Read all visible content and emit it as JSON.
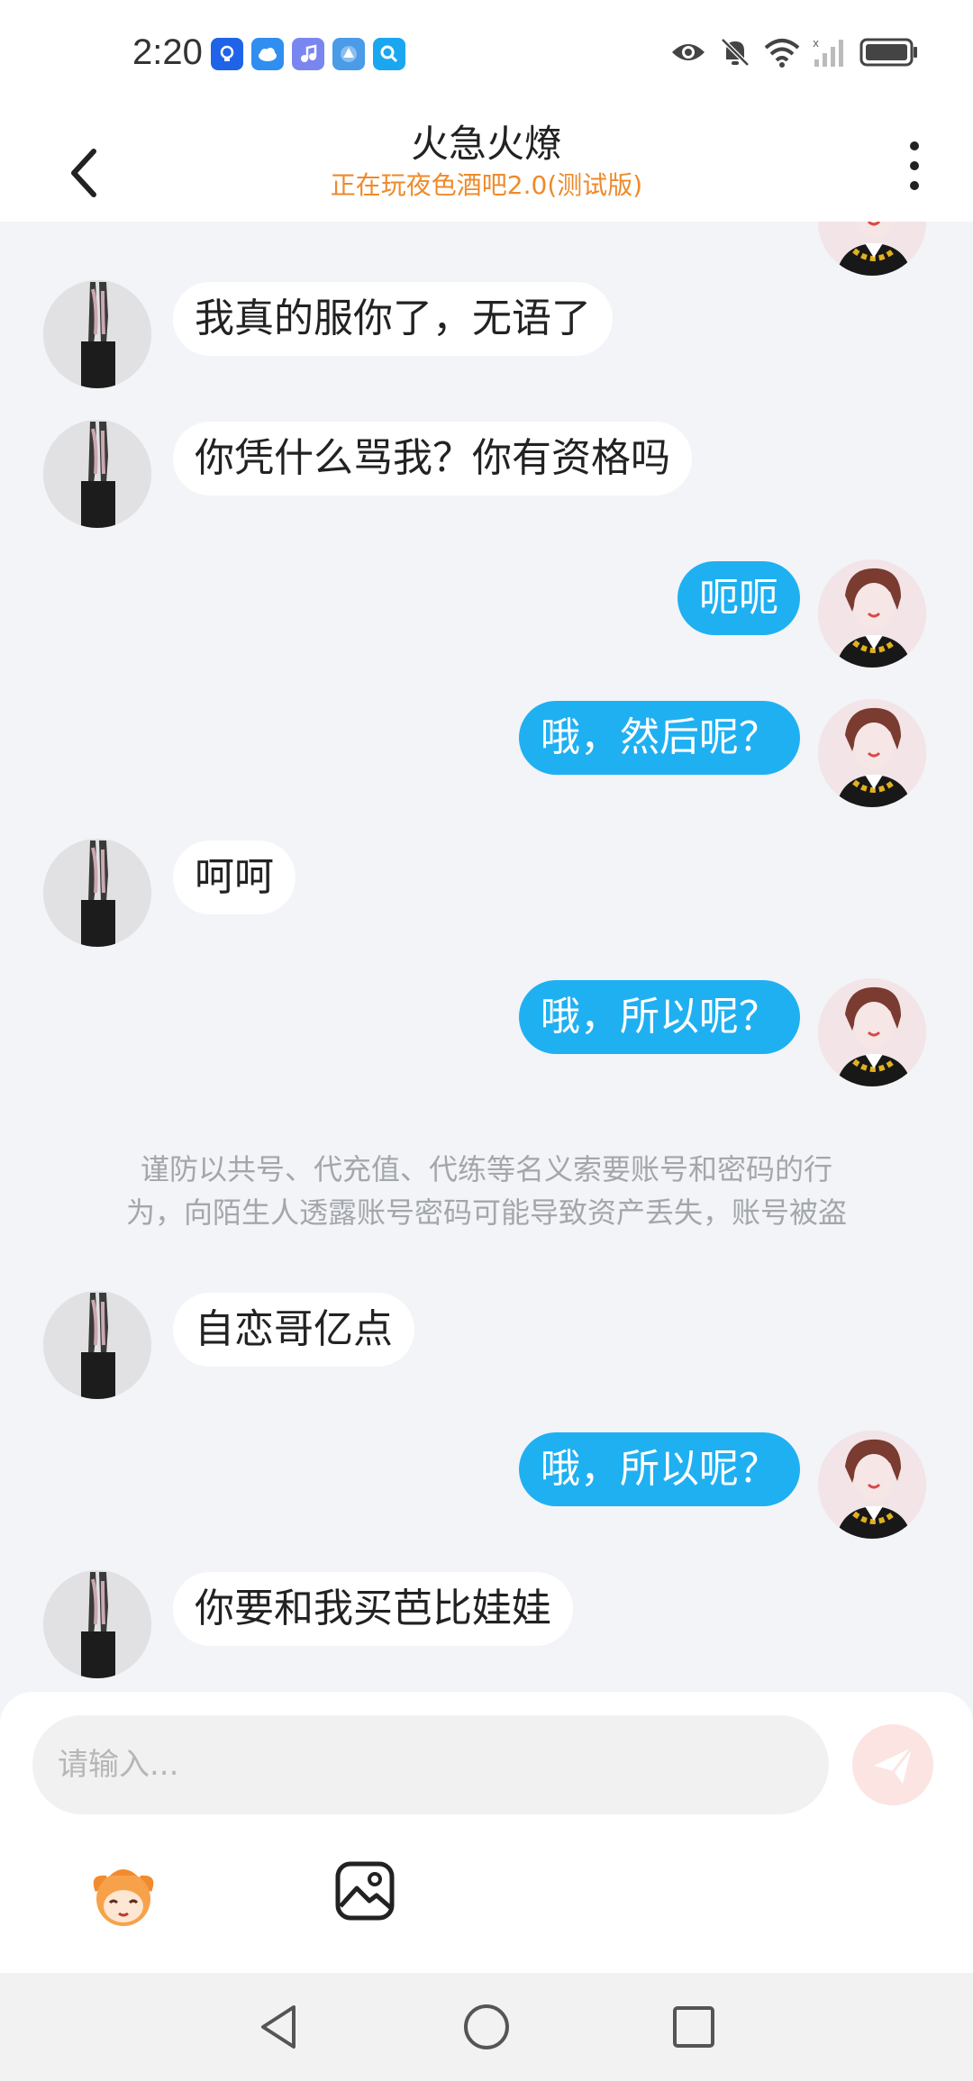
{
  "status_bar": {
    "time": "2:20",
    "app_icons": [
      "bulb-icon",
      "cloud-icon",
      "music-icon",
      "browser-icon",
      "search-icon"
    ],
    "right_icons": [
      "eye-icon",
      "mute-bell-icon",
      "wifi-icon",
      "signal-icon",
      "battery-icon"
    ]
  },
  "header": {
    "title": "火急火燎",
    "subtitle": "正在玩夜色酒吧2.0(测试版)"
  },
  "messages": [
    {
      "side": "left",
      "text": "我真的服你了，无语了"
    },
    {
      "side": "left",
      "text": "你凭什么骂我？你有资格吗"
    },
    {
      "side": "right",
      "text": "呃呃"
    },
    {
      "side": "right",
      "text": "哦，然后呢？"
    },
    {
      "side": "left",
      "text": "呵呵"
    },
    {
      "side": "right",
      "text": "哦，所以呢？"
    },
    {
      "side": "left",
      "text": "自恋哥亿点"
    },
    {
      "side": "right",
      "text": "哦，所以呢？"
    },
    {
      "side": "left",
      "text": "你要和我买芭比娃娃"
    }
  ],
  "notice": {
    "line1": "谨防以共号、代充值、代练等名义索要账号和密码的行",
    "line2": "为，向陌生人透露账号密码可能导致资产丢失，账号被盗"
  },
  "input": {
    "placeholder": "请输入..."
  },
  "colors": {
    "accent": "#1fb0f2",
    "subtitle": "#ee8a2a",
    "background": "#f2f4f7"
  }
}
